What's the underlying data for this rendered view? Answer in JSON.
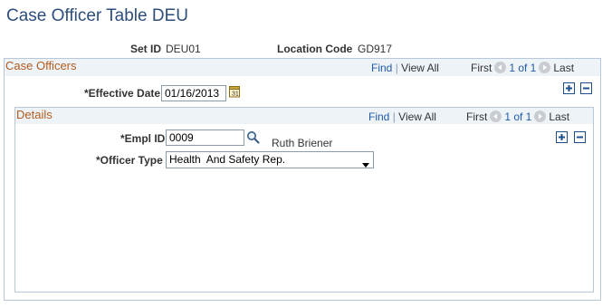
{
  "page": {
    "title": "Case Officer Table DEU",
    "set_id_label": "Set ID",
    "set_id_value": "DEU01",
    "location_code_label": "Location Code",
    "location_code_value": "GD917"
  },
  "case_officers": {
    "section_title": "Case Officers",
    "find_label": "Find",
    "view_all_label": "View All",
    "first_label": "First",
    "page_status": "1 of 1",
    "last_label": "Last",
    "effective_date_label": "*Effective Date",
    "effective_date_value": "01/16/2013",
    "calendar_icon": "calendar-icon",
    "add_icon": "plus-icon",
    "delete_icon": "minus-icon"
  },
  "details": {
    "section_title": "Details",
    "find_label": "Find",
    "view_all_label": "View All",
    "first_label": "First",
    "page_status": "1 of 1",
    "last_label": "Last",
    "empl_id_label": "*Empl ID",
    "empl_id_value": "0009",
    "lookup_icon": "magnifier-icon",
    "employee_name": "Ruth Briener",
    "officer_type_label": "*Officer Type",
    "officer_type_value": "Health  And Safety Rep."
  },
  "colors": {
    "title": "#2d4e7a",
    "section_title": "#b35b1c",
    "link": "#1f5aa6",
    "border": "#b7c7d8",
    "header_bar": "#eef3f8"
  }
}
